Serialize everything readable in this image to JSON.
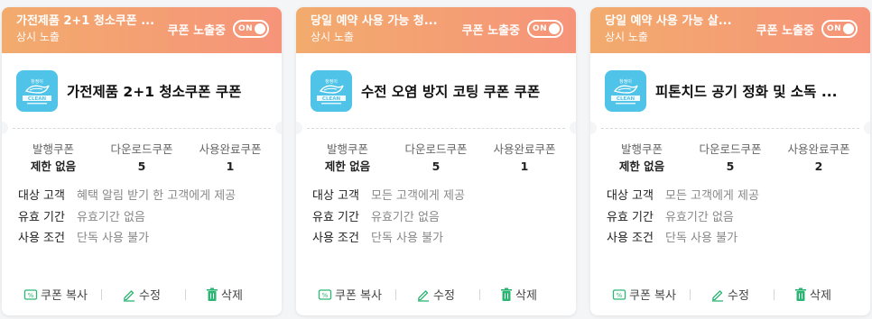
{
  "colors": {
    "header_start": "#f2ab6d",
    "header_end": "#f6947a",
    "action_icon": "#2bb673",
    "logo_bg": "#4fc4e8"
  },
  "labels": {
    "expose": "쿠폰 노출중",
    "toggle": "ON",
    "stat_issued": "발행쿠폰",
    "stat_downloaded": "다운로드쿠폰",
    "stat_used": "사용완료쿠폰",
    "target": "대상 고객",
    "validity": "유효 기간",
    "condition": "사용 조건",
    "copy": "쿠폰 복사",
    "edit": "수정",
    "delete": "삭제"
  },
  "cards": [
    {
      "header_title": "가전제품 2+1 청소쿠폰 ...",
      "header_sub": "상시 노출",
      "name": "가전제품 2+1 청소쿠폰 쿠폰",
      "issued": "제한 없음",
      "downloaded": "5",
      "used": "1",
      "target": "혜택 알림 받기 한 고객에게 제공",
      "validity": "유효기간 없음",
      "condition": "단독 사용 불가"
    },
    {
      "header_title": "당일 예약 사용 가능 청...",
      "header_sub": "상시 노출",
      "name": "수전 오염 방지 코팅 쿠폰 쿠폰",
      "issued": "제한 없음",
      "downloaded": "5",
      "used": "1",
      "target": "모든 고객에게 제공",
      "validity": "유효기간 없음",
      "condition": "단독 사용 불가"
    },
    {
      "header_title": "당일 예약 사용 가능 살...",
      "header_sub": "상시 노출",
      "name": "피톤치드 공기 정화 및 소독 ...",
      "issued": "제한 없음",
      "downloaded": "5",
      "used": "2",
      "target": "모든 고객에게 제공",
      "validity": "유효기간 없음",
      "condition": "단독 사용 불가"
    }
  ]
}
